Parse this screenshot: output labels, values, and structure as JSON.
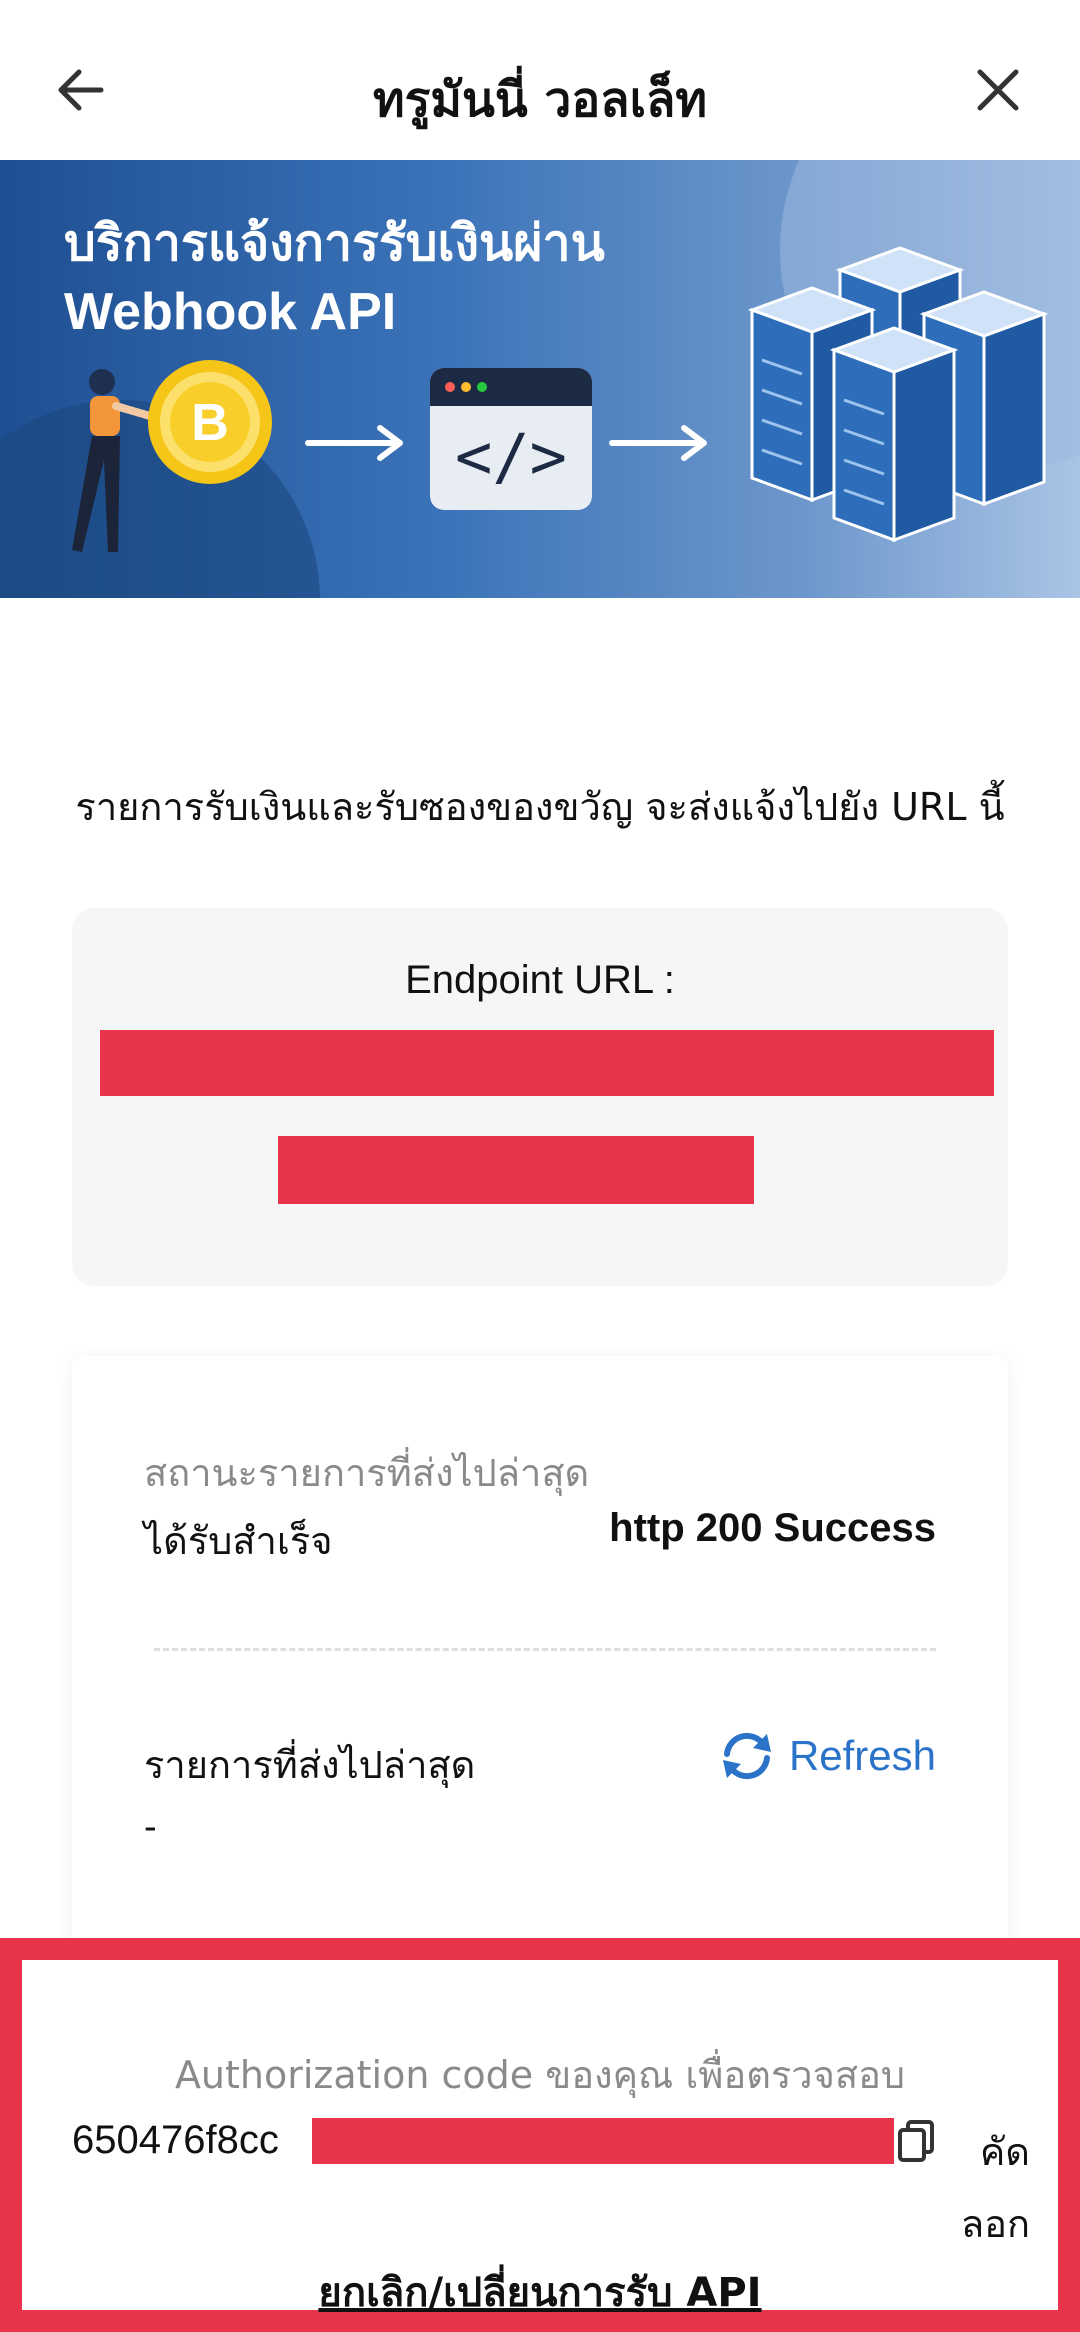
{
  "header": {
    "title": "ทรูมันนี่ วอลเล็ท",
    "back_icon": "arrow-left-icon",
    "close_icon": "close-icon"
  },
  "banner": {
    "line1": "บริการแจ้งการรับเงินผ่าน",
    "line2": "Webhook API"
  },
  "subtitle": "รายการรับเงินและรับซองของขวัญ จะส่งแจ้งไปยัง URL นี้",
  "endpoint": {
    "label": "Endpoint URL :"
  },
  "status": {
    "label": "สถานะรายการที่ส่งไปล่าสุด",
    "sub_label": "ได้รับสำเร็จ",
    "code": "http 200 Success",
    "latest_label": "รายการที่ส่งไปล่าสุด",
    "latest_value": "-",
    "refresh_label": "Refresh"
  },
  "auth": {
    "label": "Authorization code ของคุณ เพื่อตรวจสอบ",
    "code_visible": "650476f8cc",
    "copy_label": "คัดลอก",
    "cancel_link": "ยกเลิก/เปลี่ยนการรับ API"
  },
  "colors": {
    "accent": "#2b73c9",
    "redaction": "#e8344a",
    "banner": "#3a72b8"
  }
}
